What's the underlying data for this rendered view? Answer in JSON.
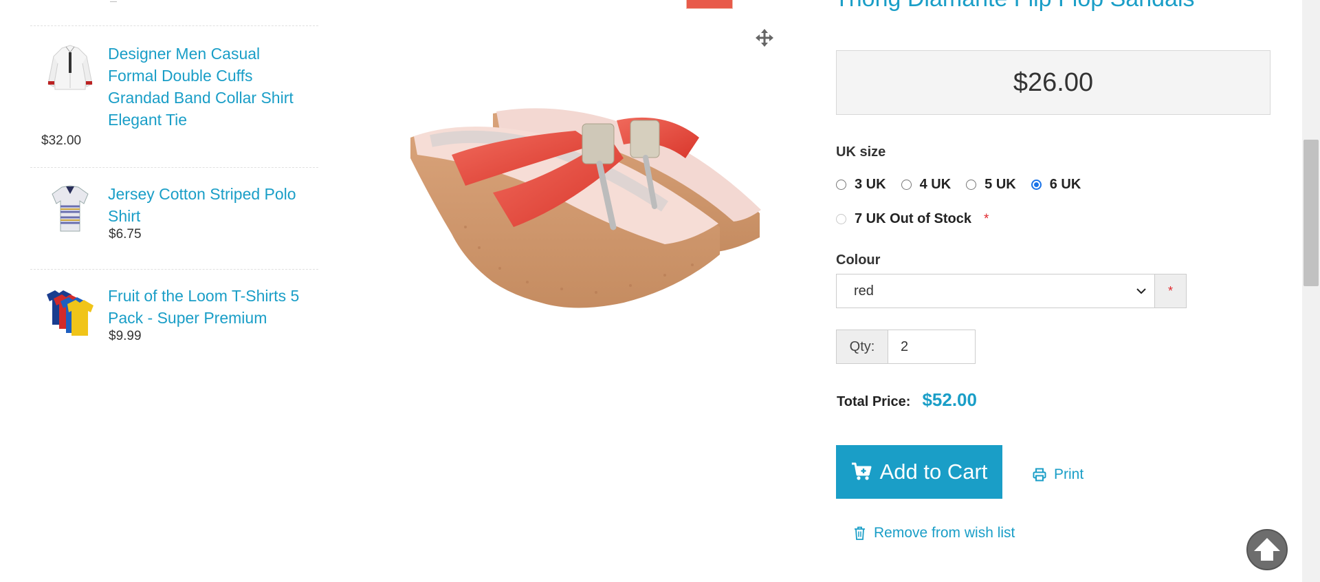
{
  "sidebar": {
    "items": [
      {
        "title": "Designer Men Casual Formal Double Cuffs Grandad Band Collar Shirt Elegant Tie",
        "price": "$32.00"
      },
      {
        "title": "Jersey Cotton Striped Polo Shirt",
        "price": "$6.75"
      },
      {
        "title": "Fruit of the Loom T-Shirts 5 Pack - Super Premium",
        "price": "$9.99"
      }
    ]
  },
  "product": {
    "title": "Thong Diamante Flip Flop Sandals",
    "price": "$26.00"
  },
  "options": {
    "size_label": "UK size",
    "sizes": [
      "3 UK",
      "4 UK",
      "5 UK",
      "6 UK",
      "7 UK Out of Stock"
    ],
    "selected_size": "6 UK",
    "required_mark": "*",
    "colour_label": "Colour",
    "colour_value": "red"
  },
  "qty": {
    "label": "Qty:",
    "value": "2"
  },
  "total": {
    "label": "Total Price:",
    "value": "$52.00"
  },
  "actions": {
    "add_to_cart": "Add to Cart",
    "print": "Print",
    "remove_wishlist": "Remove from wish list"
  },
  "colors": {
    "accent": "#1a9ec7",
    "required": "#e0282e",
    "sandal": "#e8493f"
  },
  "icons": [
    "move-icon",
    "cart-plus-icon",
    "printer-icon",
    "trash-icon",
    "chevron-down-icon",
    "back-to-top-icon"
  ]
}
